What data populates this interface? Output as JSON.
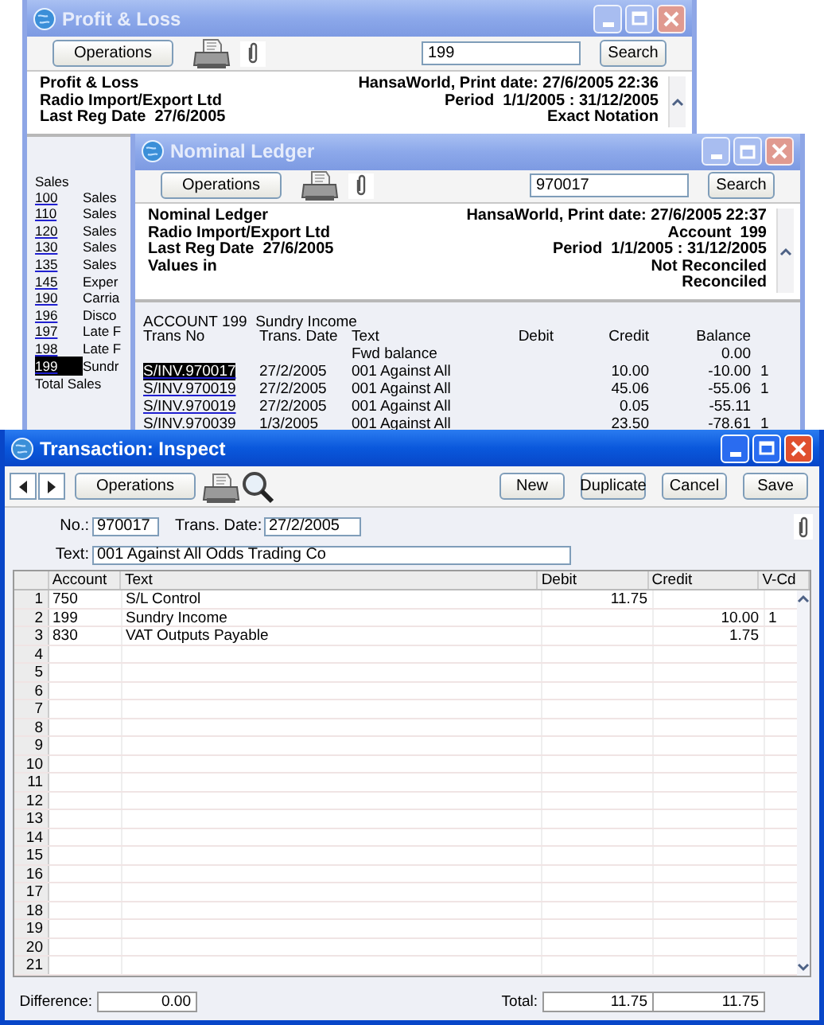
{
  "profit_loss": {
    "title": "Profit & Loss",
    "active": false,
    "operations": "Operations",
    "search_value": "199",
    "search_button": "Search",
    "header_left": [
      "Profit & Loss",
      "Radio Import/Export Ltd",
      "Last Reg Date  27/6/2005"
    ],
    "header_right": [
      "HansaWorld, Print date: 27/6/2005 22:36",
      "Period  1/1/2005 : 31/12/2005",
      "Exact Notation"
    ],
    "section": "Sales",
    "accounts": [
      {
        "number": "100",
        "name": "Sales",
        "selected": false
      },
      {
        "number": "110",
        "name": "Sales",
        "selected": false
      },
      {
        "number": "120",
        "name": "Sales",
        "selected": false
      },
      {
        "number": "130",
        "name": "Sales",
        "selected": false
      },
      {
        "number": "135",
        "name": "Sales",
        "selected": false
      },
      {
        "number": "145",
        "name": "Exper",
        "selected": false
      },
      {
        "number": "190",
        "name": "Carria",
        "selected": false
      },
      {
        "number": "196",
        "name": "Disco",
        "selected": false
      },
      {
        "number": "197",
        "name": "Late F",
        "selected": false
      },
      {
        "number": "198",
        "name": "Late F",
        "selected": false
      },
      {
        "number": "199",
        "name": "Sundr",
        "selected": true
      }
    ],
    "total": "Total Sales"
  },
  "nominal_ledger": {
    "title": "Nominal Ledger",
    "active": false,
    "operations": "Operations",
    "search_value": "970017",
    "search_button": "Search",
    "header_left": [
      "Nominal Ledger",
      "Radio Import/Export Ltd",
      "Last Reg Date  27/6/2005",
      "Values in"
    ],
    "header_right": [
      "HansaWorld, Print date: 27/6/2005 22:37",
      "Account  199",
      "Period  1/1/2005 : 31/12/2005",
      "Not Reconciled",
      "Reconciled"
    ],
    "account_heading": "ACCOUNT 199  Sundry Income",
    "columns": [
      "Trans No",
      "Trans. Date",
      "Text",
      "Debit",
      "Credit",
      "Balance"
    ],
    "fwd_text": "Fwd balance",
    "fwd_balance": "0.00",
    "rows": [
      {
        "trans_no": "S/INV.970017",
        "date": "27/2/2005",
        "text": "001 Against All",
        "credit": "10.00",
        "balance": "-10.00",
        "flag": "1",
        "selected": true
      },
      {
        "trans_no": "S/INV.970019",
        "date": "27/2/2005",
        "text": "001 Against All",
        "credit": "45.06",
        "balance": "-55.06",
        "flag": "1",
        "selected": false
      },
      {
        "trans_no": "S/INV.970019",
        "date": "27/2/2005",
        "text": "001 Against All",
        "credit": "0.05",
        "balance": "-55.11",
        "selected": false
      },
      {
        "trans_no": "S/INV.970039",
        "date": "1/3/2005",
        "text": "001 Against All",
        "credit": "23.50",
        "balance": "-78.61",
        "flag": "1",
        "selected": false
      }
    ]
  },
  "transaction": {
    "title": "Transaction: Inspect",
    "active": true,
    "operations": "Operations",
    "buttons": [
      "New",
      "Duplicate",
      "Cancel",
      "Save"
    ],
    "no_label": "No.:",
    "no": "970017",
    "date_label": "Trans. Date:",
    "date": "27/2/2005",
    "text_label": "Text:",
    "text": "001 Against All Odds Trading Co",
    "columns": [
      "Account",
      "Text",
      "Debit",
      "Credit",
      "V-Cd"
    ],
    "rows": [
      {
        "number": "1",
        "account": "750",
        "text": "S/L Control",
        "debit": "11.75"
      },
      {
        "number": "2",
        "account": "199",
        "text": "Sundry Income",
        "credit": "10.00",
        "vat_code": "1"
      },
      {
        "number": "3",
        "account": "830",
        "text": "VAT Outputs Payable",
        "credit": "1.75"
      },
      {
        "number": "4"
      },
      {
        "number": "5"
      },
      {
        "number": "6"
      },
      {
        "number": "7"
      },
      {
        "number": "8"
      },
      {
        "number": "9"
      },
      {
        "number": "10"
      },
      {
        "number": "11"
      },
      {
        "number": "12"
      },
      {
        "number": "13"
      },
      {
        "number": "14"
      },
      {
        "number": "15"
      },
      {
        "number": "16"
      },
      {
        "number": "17"
      },
      {
        "number": "18"
      },
      {
        "number": "19"
      },
      {
        "number": "20"
      },
      {
        "number": "21"
      }
    ],
    "difference_label": "Difference:",
    "difference": "0.00",
    "total_label": "Total:",
    "total_debit": "11.75",
    "total_credit": "11.75"
  }
}
